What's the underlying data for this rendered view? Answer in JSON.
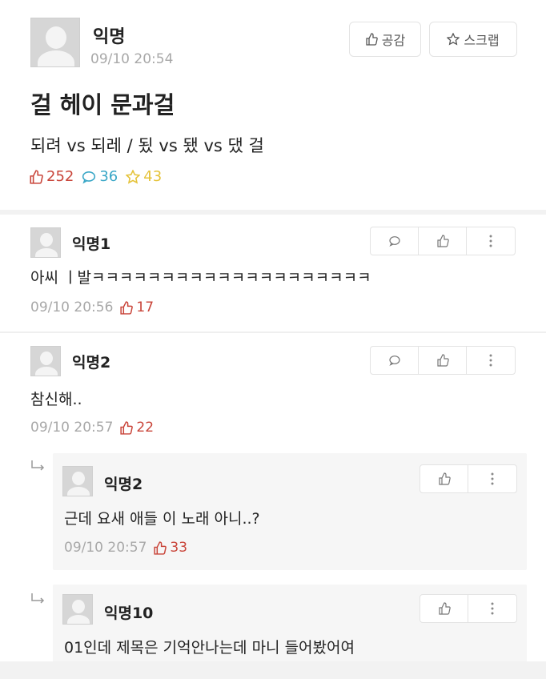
{
  "post": {
    "author": "익명",
    "time": "09/10 20:54",
    "title": "걸 헤이 문과걸",
    "body": "되려 vs 되레 / 됬 vs 됐 vs 댔 걸",
    "stats": {
      "likes": "252",
      "comments": "36",
      "scraps": "43"
    },
    "buttons": {
      "like": "공감",
      "scrap": "스크랩"
    }
  },
  "comments": [
    {
      "author": "익명1",
      "text": "아씨 ㅣ발ㅋㅋㅋㅋㅋㅋㅋㅋㅋㅋㅋㅋㅋㅋㅋㅋㅋㅋㅋㅋ",
      "time": "09/10 20:56",
      "likes": "17"
    },
    {
      "author": "익명2",
      "text": "참신해..",
      "time": "09/10 20:57",
      "likes": "22"
    }
  ],
  "replies": [
    {
      "author": "익명2",
      "text": "근데 요새 애들 이 노래 아니..?",
      "time": "09/10 20:57",
      "likes": "33"
    },
    {
      "author": "익명10",
      "text": "01인데 제목은 기억안나는데 마니 들어봤어여"
    }
  ],
  "colors": {
    "like": "#c9453a",
    "comment": "#3aa7c7",
    "scrap": "#e5c33a",
    "meta": "#a8a8a8"
  }
}
